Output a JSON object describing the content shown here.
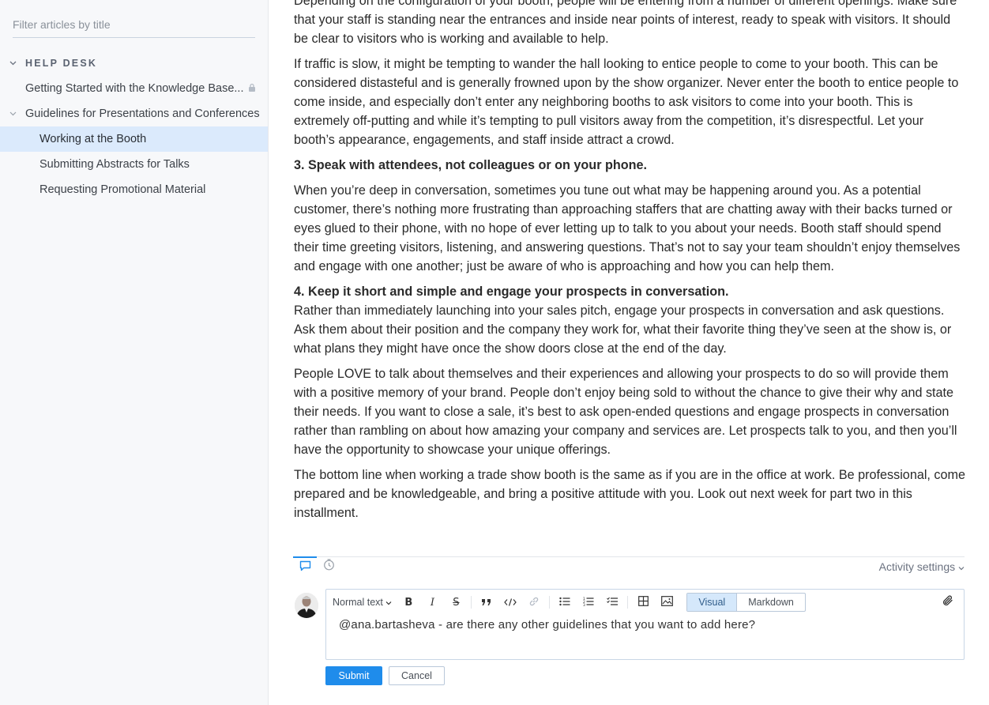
{
  "sidebar": {
    "filter_placeholder": "Filter articles by title",
    "section_label": "HELP DESK",
    "items": [
      {
        "label": "Getting Started with the Knowledge Base..."
      },
      {
        "label": "Guidelines for Presentations and Conferences"
      },
      {
        "label": "Working at the Booth"
      },
      {
        "label": "Submitting Abstracts for Talks"
      },
      {
        "label": "Requesting Promotional Material"
      }
    ]
  },
  "article": {
    "p0": "Depending on the configuration of your booth, people will be entering from a number of different openings. Make sure that your staff is standing near the entrances and inside near points of interest, ready to speak with visitors. It should be clear to visitors who is working and available to help.",
    "p1": "If traffic is slow, it might be tempting to wander the hall looking to entice people to come to your booth. This can be considered distasteful and is generally frowned upon by the show organizer. Never enter the booth to entice people to come inside, and especially don’t enter any neighboring booths to ask visitors to come into your booth. This is extremely off-putting and while it’s tempting to pull visitors away from the competition, it’s disrespectful. Let your booth’s appearance, engagements, and staff inside attract a crowd.",
    "h3": "3. Speak with attendees, not colleagues or on your phone.",
    "p2": "When you’re deep in conversation, sometimes you tune out what may be happening around you. As a potential customer, there’s nothing more frustrating than approaching staffers that are chatting away with their backs turned or eyes glued to their phone, with no hope of ever letting up to talk to you about your needs. Booth staff should spend their time greeting visitors, listening, and answering questions. That’s not to say your team shouldn’t enjoy themselves and engage with one another; just be aware of who is approaching and how you can help them.",
    "h4": "4. Keep it short and simple and engage your prospects in conversation.",
    "p3": "Rather than immediately launching into your sales pitch, engage your prospects in conversation and ask questions. Ask them about their position and the company they work for, what their favorite thing they’ve seen at the show is, or what plans they might have once the show doors close at the end of the day.",
    "p4": "People LOVE to talk about themselves and their experiences and allowing your prospects to do so will provide them with a positive memory of your brand. People don’t enjoy being sold to without the chance to give their why and state their needs. If you want to close a sale, it’s best to ask open-ended questions and engage prospects in conversation rather than rambling on about how amazing your company and services are. Let prospects talk to you, and then you’ll have the opportunity to showcase your unique offerings.",
    "p5": "The bottom line when working a trade show booth is the same as if you are in the office at work. Be professional, come prepared and be knowledgeable, and bring a positive attitude with you. Look out next week for part two in this installment."
  },
  "activity": {
    "settings_label": "Activity settings"
  },
  "editor": {
    "text_style": "Normal text",
    "mode_visual": "Visual",
    "mode_markdown": "Markdown",
    "content": "@ana.bartasheva - are there any other guidelines that you want to add here?",
    "submit_label": "Submit",
    "cancel_label": "Cancel"
  },
  "colors": {
    "accent": "#1f8ceb",
    "active_nav_bg": "#dbeafc",
    "sidebar_bg": "#f7f8fa"
  }
}
